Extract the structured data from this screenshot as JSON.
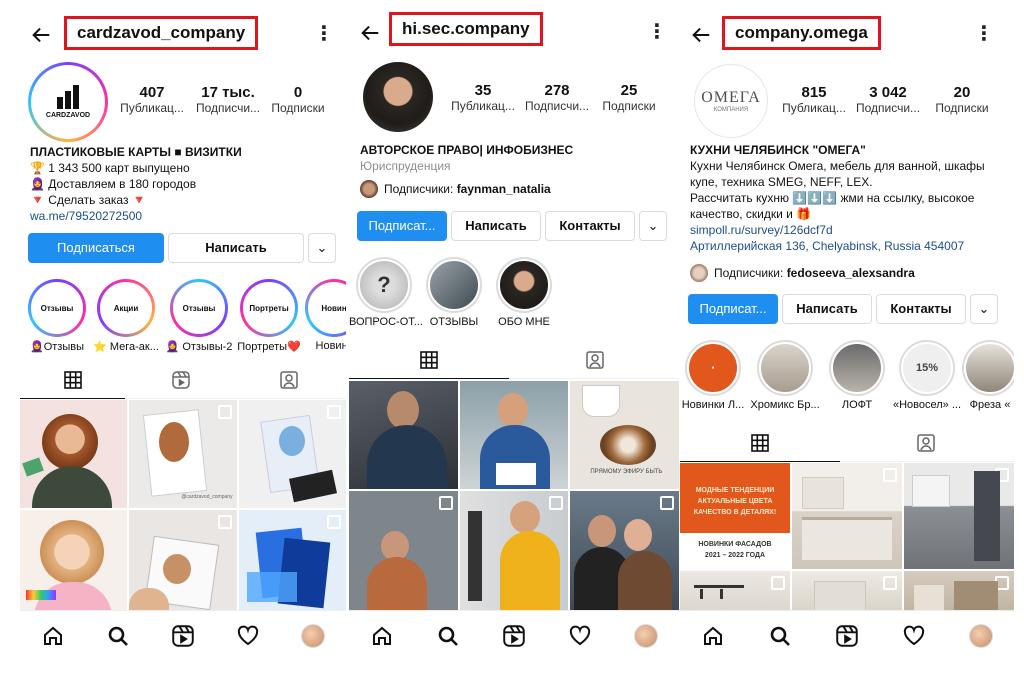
{
  "panels": [
    {
      "username": "cardzavod_company",
      "avatar_text": "CARDZAVOD",
      "stats": [
        {
          "num": "407",
          "label": "Публикац..."
        },
        {
          "num": "17 тыс.",
          "label": "Подписчи..."
        },
        {
          "num": "0",
          "label": "Подписки"
        }
      ],
      "bio": {
        "name": "ПЛАСТИКОВЫЕ КАРТЫ ■ ВИЗИТКИ",
        "lines": [
          "🏆 1 343 500 карт выпущено",
          "🧕 Доставляем в 180 городов",
          "🔻 Сделать заказ 🔻"
        ],
        "link": "wa.me/79520272500"
      },
      "buttons": {
        "follow": "Подписаться",
        "message": "Написать",
        "more": "⌄"
      },
      "highlights": [
        {
          "inner": "Отзывы",
          "caption": "🧕Отзывы"
        },
        {
          "inner": "Акции",
          "caption": "⭐ Мега-ак..."
        },
        {
          "inner": "Отзывы",
          "caption": "🧕 Отзывы-2"
        },
        {
          "inner": "Портреты",
          "caption": "Портреты❤️"
        },
        {
          "inner": "Новин",
          "caption": "Новинк"
        }
      ],
      "grid_caption": "@cardzavod_company"
    },
    {
      "username": "hi.sec.company",
      "stats": [
        {
          "num": "35",
          "label": "Публикац..."
        },
        {
          "num": "278",
          "label": "Подписчи..."
        },
        {
          "num": "25",
          "label": "Подписки"
        }
      ],
      "bio": {
        "name": "АВТОРСКОЕ ПРАВО| ИНФОБИЗНЕС",
        "category": "Юриспруденция",
        "followers_prefix": "Подписчики: ",
        "followers_name": "faynman_natalia"
      },
      "buttons": {
        "follow": "Подписат...",
        "message": "Написать",
        "contacts": "Контакты",
        "more": "⌄"
      },
      "highlights": [
        {
          "caption": "ВОПРОС-ОТ..."
        },
        {
          "caption": "ОТЗЫВЫ"
        },
        {
          "caption": "ОБО МНЕ"
        }
      ],
      "grid_caption": "ПРЯМОМУ ЭФИРУ БЫТЬ"
    },
    {
      "username": "company.omega",
      "avatar_text": "ОМЕГА",
      "avatar_sub": "КОМПАНИЯ",
      "stats": [
        {
          "num": "815",
          "label": "Публикац..."
        },
        {
          "num": "3 042",
          "label": "Подписчи..."
        },
        {
          "num": "20",
          "label": "Подписки"
        }
      ],
      "bio": {
        "name": "КУХНИ ЧЕЛЯБИНСК \"ОМЕГА\"",
        "lines": [
          "Кухни Челябинск Омега, мебель для ванной, шкафы",
          "купе, техника SMEG, NEFF, LEX.",
          "Рассчитать кухню ⬇️⬇️⬇️ жми на ссылку, высокое",
          "качество, скидки и 🎁"
        ],
        "link": "simpoll.ru/survey/126dcf7d",
        "address": "Артиллерийская 136, Chelyabinsk, Russia 454007",
        "followers_prefix": "Подписчики: ",
        "followers_name": "fedoseeva_alexsandra"
      },
      "buttons": {
        "follow": "Подписат...",
        "message": "Написать",
        "contacts": "Контакты",
        "more": "⌄"
      },
      "highlights": [
        {
          "caption": "Новинки Л..."
        },
        {
          "caption": "Хромикс Бр..."
        },
        {
          "caption": "ЛОФТ"
        },
        {
          "caption": "«Новосел» ..."
        },
        {
          "caption": "Фреза «"
        }
      ],
      "promo": {
        "line1": "МОДНЫЕ ТЕНДЕНЦИИ",
        "line2": "АКТУАЛЬНЫЕ ЦВЕТА",
        "line3": "КАЧЕСТВО В ДЕТАЛЯХ!",
        "sub1": "НОВИНКИ ФАСАДОВ",
        "sub2": "2021 – 2022 ГОДА"
      },
      "sale_badge": "15%"
    }
  ],
  "colors": {
    "accent_blue": "#1e8ff0",
    "highlight_red": "#e0141e",
    "link": "#1d4e89"
  },
  "icons": [
    "back-arrow-icon",
    "more-vertical-icon",
    "grid-icon",
    "reels-icon",
    "tagged-icon",
    "home-icon",
    "search-icon",
    "heart-icon"
  ]
}
